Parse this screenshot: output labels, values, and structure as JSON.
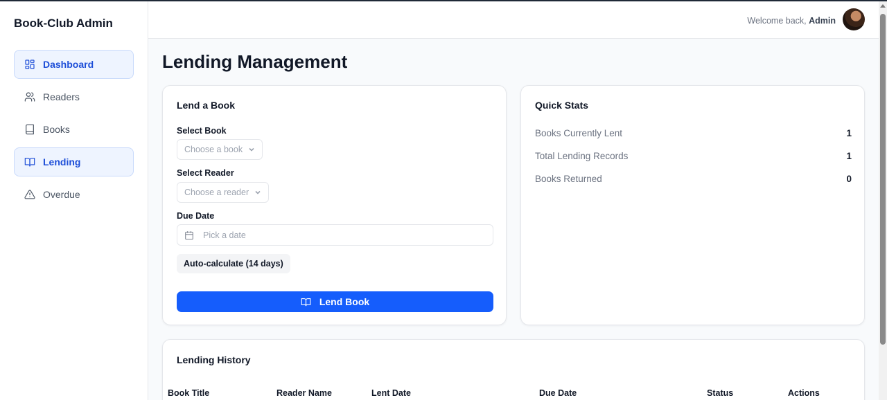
{
  "app": {
    "title": "Book-Club Admin"
  },
  "sidebar": {
    "items": [
      {
        "label": "Dashboard",
        "icon": "dashboard-grid-icon",
        "active": true
      },
      {
        "label": "Readers",
        "icon": "users-icon",
        "active": false
      },
      {
        "label": "Books",
        "icon": "book-icon",
        "active": false
      },
      {
        "label": "Lending",
        "icon": "open-book-icon",
        "active": true
      },
      {
        "label": "Overdue",
        "icon": "warning-triangle-icon",
        "active": false
      }
    ]
  },
  "header": {
    "welcome_prefix": "Welcome back,",
    "user_name": "Admin"
  },
  "page": {
    "title": "Lending Management"
  },
  "lend_form": {
    "title": "Lend a Book",
    "book_label": "Select Book",
    "book_placeholder": "Choose a book",
    "reader_label": "Select Reader",
    "reader_placeholder": "Choose a reader",
    "due_label": "Due Date",
    "due_placeholder": "Pick a date",
    "auto_label": "Auto-calculate (14 days)",
    "submit_label": "Lend Book"
  },
  "quick_stats": {
    "title": "Quick Stats",
    "rows": [
      {
        "label": "Books Currently Lent",
        "value": "1"
      },
      {
        "label": "Total Lending Records",
        "value": "1"
      },
      {
        "label": "Books Returned",
        "value": "0"
      }
    ]
  },
  "history": {
    "title": "Lending History",
    "columns": [
      "Book Title",
      "Reader Name",
      "Lent Date",
      "Due Date",
      "Status",
      "Actions"
    ]
  },
  "colors": {
    "primary": "#155dfc",
    "active_bg": "#eef4ff",
    "active_text": "#1d4ed8"
  }
}
